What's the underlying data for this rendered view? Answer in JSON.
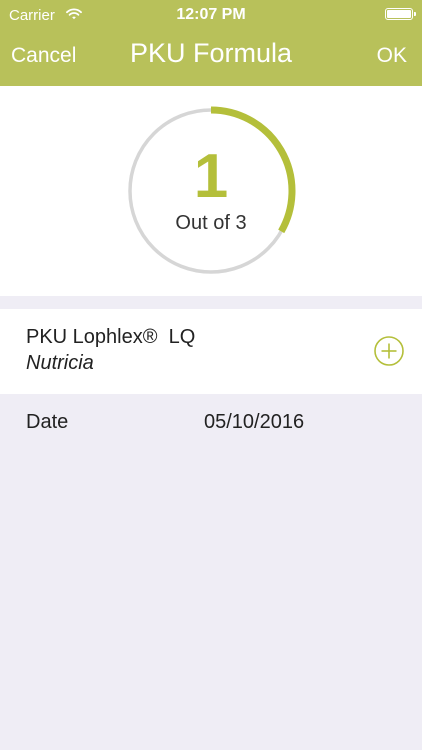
{
  "status_bar": {
    "carrier": "Carrier",
    "time": "12:07 PM"
  },
  "nav": {
    "cancel_label": "Cancel",
    "title": "PKU Formula",
    "ok_label": "OK"
  },
  "progress": {
    "count": "1",
    "caption": "Out of 3",
    "fraction": 0.333,
    "accent_color": "#b4bf3a"
  },
  "product": {
    "name": "PKU Lophlex®  LQ",
    "brand": "Nutricia"
  },
  "date": {
    "label": "Date",
    "value": "05/10/2016"
  },
  "colors": {
    "nav_bar": "#b8c15a",
    "background": "#efedf5",
    "ring_track": "#d6d6d6"
  },
  "icons": {
    "wifi": "wifi-icon",
    "battery": "battery-icon",
    "add": "plus-circle-icon"
  }
}
